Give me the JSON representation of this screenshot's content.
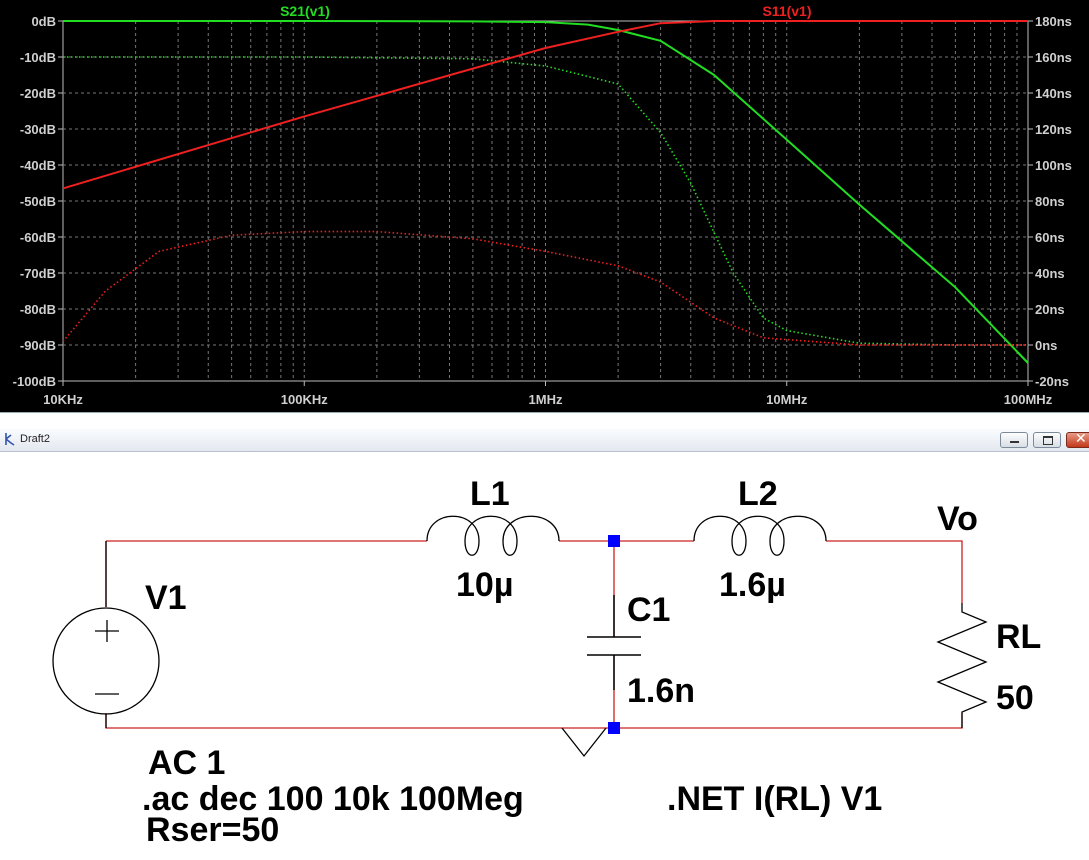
{
  "plot": {
    "trace_labels": {
      "s21": "S21(v1)",
      "s11": "S11(v1)"
    },
    "y_left_ticks": [
      "0dB",
      "-10dB",
      "-20dB",
      "-30dB",
      "-40dB",
      "-50dB",
      "-60dB",
      "-70dB",
      "-80dB",
      "-90dB",
      "-100dB"
    ],
    "y_right_ticks": [
      "180ns",
      "160ns",
      "140ns",
      "120ns",
      "100ns",
      "80ns",
      "60ns",
      "40ns",
      "20ns",
      "0ns",
      "-20ns"
    ],
    "x_ticks": [
      "10KHz",
      "100KHz",
      "1MHz",
      "10MHz",
      "100MHz"
    ],
    "colors": {
      "s21": "#22dd22",
      "s11": "#ee2020",
      "grid": "#777777",
      "axis_text": "#d0d0d0",
      "background": "#000000"
    }
  },
  "chart_data": {
    "type": "line",
    "x_scale": "log",
    "xlim": [
      10000,
      100000000
    ],
    "ylim_left_dB": [
      -100,
      0
    ],
    "ylim_right_ns": [
      -20,
      180
    ],
    "grid": true,
    "series": [
      {
        "name": "S21(v1)",
        "kind": "magnitude_dB",
        "style": "solid",
        "color": "#22dd22",
        "points": [
          [
            10000,
            0
          ],
          [
            100000,
            0
          ],
          [
            500000,
            -0.1
          ],
          [
            1000000,
            -0.3
          ],
          [
            1500000,
            -1.0
          ],
          [
            2000000,
            -2.5
          ],
          [
            3000000,
            -5.5
          ],
          [
            5000000,
            -15
          ],
          [
            10000000,
            -33
          ],
          [
            20000000,
            -51
          ],
          [
            50000000,
            -74
          ],
          [
            100000000,
            -95
          ]
        ]
      },
      {
        "name": "S21(v1)",
        "kind": "group_delay_ns",
        "style": "dotted",
        "color": "#22dd22",
        "points": [
          [
            10000,
            160
          ],
          [
            100000,
            160
          ],
          [
            500000,
            159
          ],
          [
            1000000,
            155
          ],
          [
            2000000,
            145
          ],
          [
            3000000,
            118
          ],
          [
            4000000,
            90
          ],
          [
            6000000,
            40
          ],
          [
            8000000,
            15
          ],
          [
            10000000,
            8
          ],
          [
            20000000,
            1
          ],
          [
            50000000,
            0
          ],
          [
            100000000,
            0
          ]
        ]
      },
      {
        "name": "S11(v1)",
        "kind": "magnitude_dB",
        "style": "solid",
        "color": "#ee2020",
        "points": [
          [
            10000,
            -46.5
          ],
          [
            100000,
            -26.5
          ],
          [
            1000000,
            -7.5
          ],
          [
            2000000,
            -3
          ],
          [
            3000000,
            -0.6
          ],
          [
            5000000,
            0
          ],
          [
            100000000,
            0
          ]
        ]
      },
      {
        "name": "S11(v1)",
        "kind": "group_delay_ns",
        "style": "dotted",
        "color": "#ee2020",
        "points": [
          [
            10000,
            2
          ],
          [
            15000,
            30
          ],
          [
            25000,
            52
          ],
          [
            50000,
            61
          ],
          [
            100000,
            63
          ],
          [
            200000,
            63
          ],
          [
            500000,
            59
          ],
          [
            1000000,
            52
          ],
          [
            2000000,
            44
          ],
          [
            3000000,
            35
          ],
          [
            5000000,
            15
          ],
          [
            8000000,
            4
          ],
          [
            20000000,
            0
          ],
          [
            100000000,
            0
          ]
        ]
      }
    ]
  },
  "window": {
    "title": "Draft2"
  },
  "schematic": {
    "V1": {
      "name": "V1"
    },
    "L1": {
      "name": "L1",
      "value": "10µ"
    },
    "L2": {
      "name": "L2",
      "value": "1.6µ"
    },
    "C1": {
      "name": "C1",
      "value": "1.6n"
    },
    "RL": {
      "name": "RL",
      "value": "50"
    },
    "net_label": "Vo",
    "source_line1": "AC 1",
    "source_line2": ".ac dec 100 10k 100Meg",
    "source_line3": "Rser=50",
    "directive": ".NET I(RL) V1",
    "wire_color": "#cc2020",
    "junction_color": "#0000ff"
  }
}
